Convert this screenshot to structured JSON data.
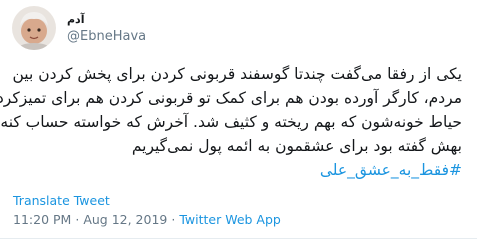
{
  "user": {
    "display_name": "آدم",
    "handle": "@EbneHava"
  },
  "tweet": {
    "lines": [
      "یکی از رفقا می‌گفت چندتا گوسفند قربونی کردن برای پخش کردن بین",
      "مردم، کارگر آورده بودن هم برای کمک تو قربونی کردن هم برای تمیزکردن",
      "حیاط خونه‌شون که بهم ریخته و کثیف شد. آخرش که خواسته حساب کنه",
      "بهش گفته بود برای عشقمون به ائمه پول نمی‌گیریم"
    ],
    "hashtag": "#فقط_به_عشق_علی"
  },
  "translate_label": "Translate Tweet",
  "meta": {
    "time": "11:20 PM",
    "separator": "·",
    "date": "Aug 12, 2019",
    "source": "Twitter Web App"
  }
}
